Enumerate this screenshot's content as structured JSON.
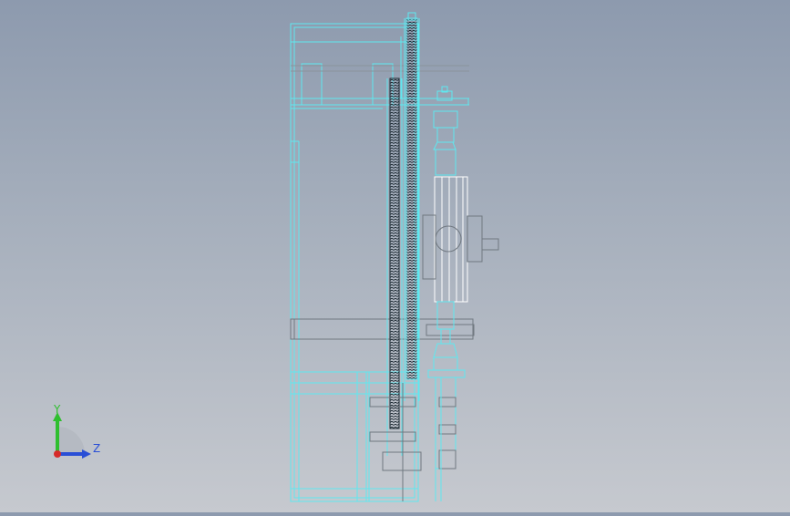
{
  "viewport": {
    "background_top": "#8d9aae",
    "background_bottom": "#c6c9cf",
    "wire_color": "#5ee8f0",
    "wire_dark": "#1d2a33",
    "wire_gray": "#707880",
    "highlight_white": "#ffffff"
  },
  "triad": {
    "y_label": "Y",
    "z_label": "Z",
    "y_color": "#2fbf2f",
    "z_color": "#2a4fd6",
    "x_color": "#d62a2a"
  }
}
